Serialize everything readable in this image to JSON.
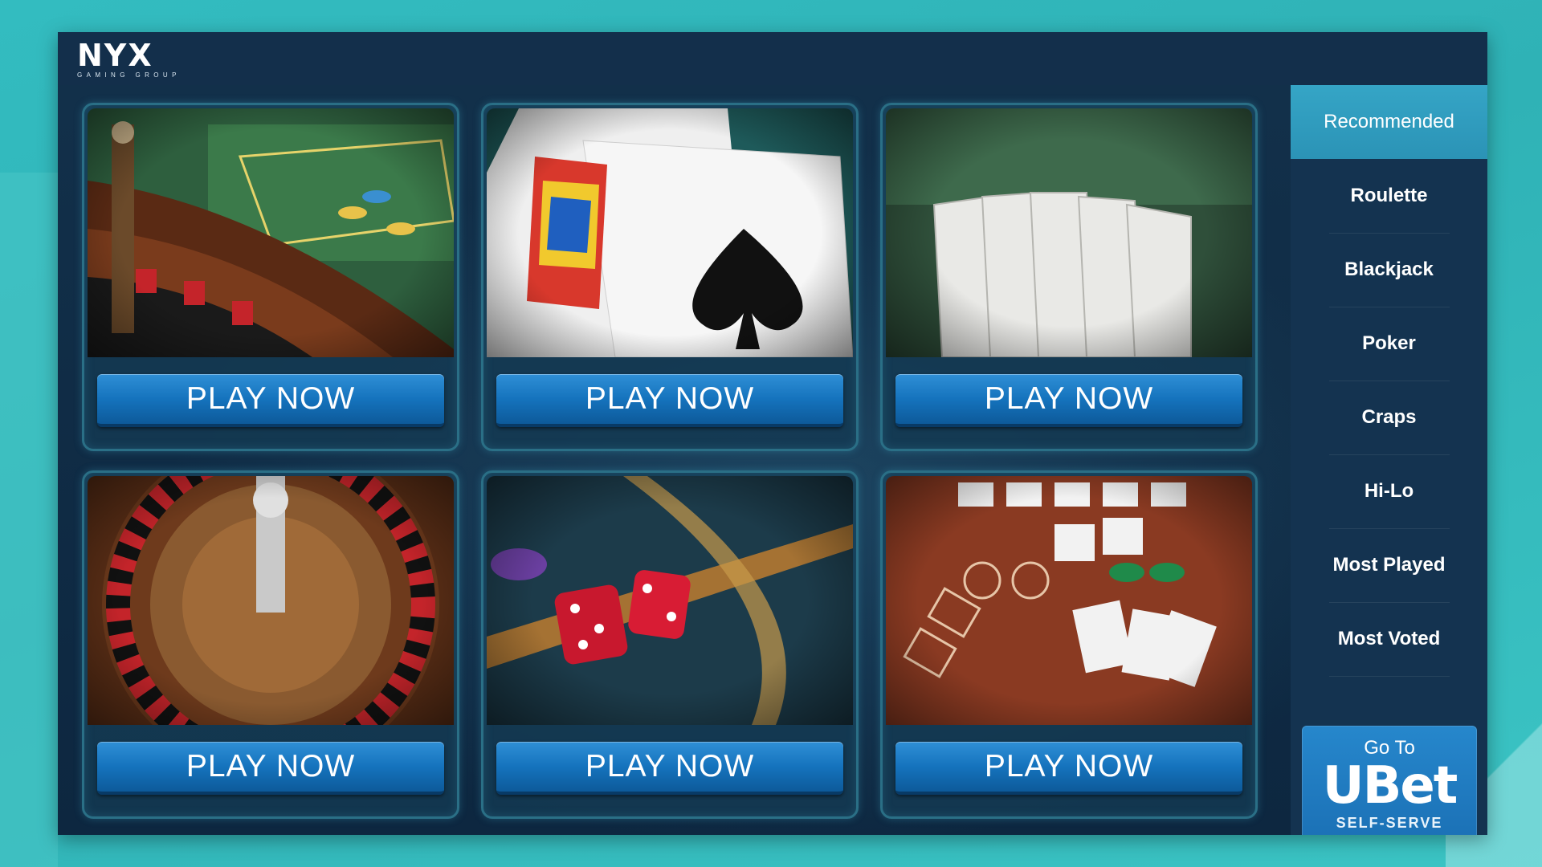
{
  "header": {
    "logo_text": "NYX",
    "logo_subtitle": "GAMING GROUP"
  },
  "games": [
    {
      "image": "roulette-table-photo",
      "button_label": "PLAY NOW"
    },
    {
      "image": "blackjack-cards-photo",
      "button_label": "PLAY NOW"
    },
    {
      "image": "poker-royal-flush-photo",
      "button_label": "PLAY NOW"
    },
    {
      "image": "roulette-wheel-photo",
      "button_label": "PLAY NOW"
    },
    {
      "image": "craps-dice-photo",
      "button_label": "PLAY NOW"
    },
    {
      "image": "hi-lo-table-photo",
      "button_label": "PLAY NOW"
    }
  ],
  "sidebar": {
    "items": [
      {
        "label": "Recommended",
        "active": true
      },
      {
        "label": "Roulette",
        "active": false
      },
      {
        "label": "Blackjack",
        "active": false
      },
      {
        "label": "Poker",
        "active": false
      },
      {
        "label": "Craps",
        "active": false
      },
      {
        "label": "Hi-Lo",
        "active": false
      },
      {
        "label": "Most Played",
        "active": false
      },
      {
        "label": "Most Voted",
        "active": false
      }
    ],
    "promo": {
      "goto": "Go To",
      "brand": "UBet",
      "subtitle": "SELF-SERVE SPORTS"
    }
  },
  "colors": {
    "background": "#33bcc0",
    "panel": "#0f2a44",
    "sidebar": "#143350",
    "active_tab": "#35a5c6",
    "button": "#1573bd"
  }
}
